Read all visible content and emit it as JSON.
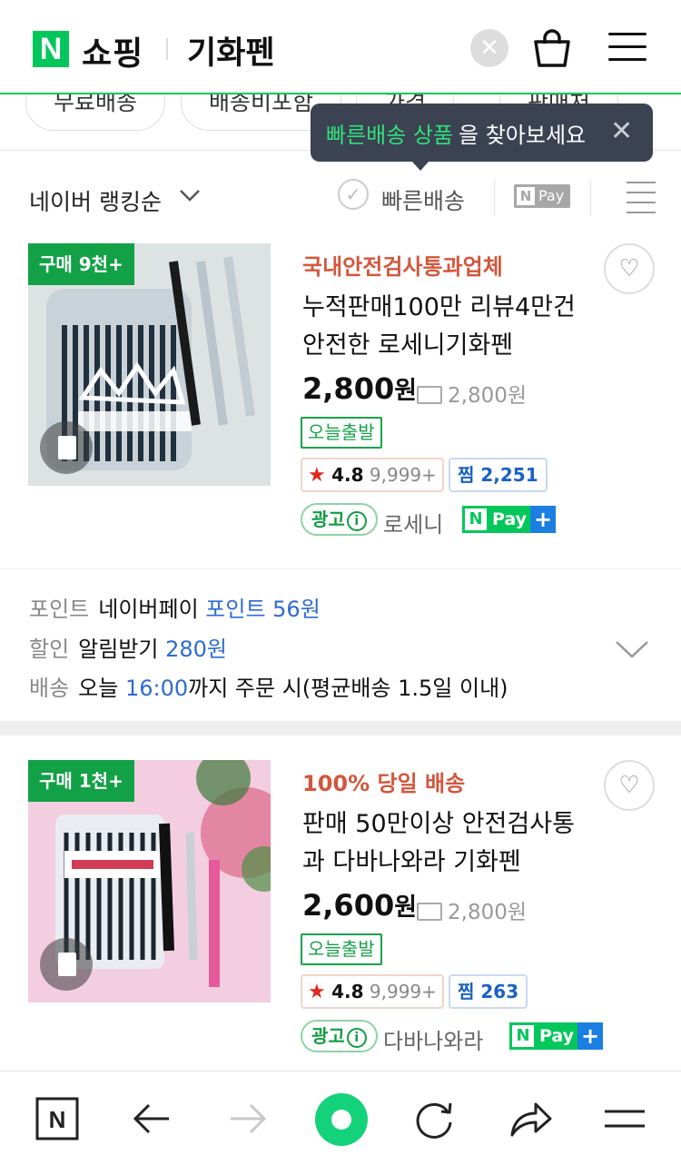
{
  "header": {
    "logo_letter": "N",
    "logo_text": "쇼핑",
    "query": "기화펜",
    "clear_glyph": "✕",
    "icons": [
      "search-clear-icon",
      "shopping-bag-icon",
      "hamburger-menu-icon"
    ]
  },
  "filters": {
    "chips": [
      "무료배송",
      "배송비포함",
      "가격",
      "판매처"
    ]
  },
  "tooltip": {
    "highlight": "빠른배송 상품",
    "text": "을 찾아보세요",
    "close": "✕"
  },
  "sort": {
    "label": "네이버 랭킹순",
    "chevron": "⌵",
    "fast_delivery": "빠른배송",
    "check": "✓",
    "npay_n": "N",
    "npay_label": "Pay"
  },
  "products": [
    {
      "buy_badge": "구매 9천+",
      "promo": "국내안전검사통과업체",
      "title": "누적판매100만 리뷰4만건 안전한 로세니기화펜",
      "price": "2,800",
      "price_unit": "원",
      "shipping": "2,800원",
      "today_ship": "오늘출발",
      "rating_star": "★",
      "rating": "4.8",
      "review_count": "9,999+",
      "zzim": "찜 2,251",
      "ad_label": "광고",
      "ad_icon": "i",
      "seller": "로세니",
      "npay_n": "N",
      "npay_label": "Pay",
      "npay_plus": "+",
      "wish_icon": "♡"
    },
    {
      "buy_badge": "구매 1천+",
      "promo": "100% 당일 배송",
      "title": "판매 50만이상 안전검사통과 다바나와라 기화펜",
      "price": "2,600",
      "price_unit": "원",
      "shipping": "2,800원",
      "today_ship": "오늘출발",
      "rating_star": "★",
      "rating": "4.8",
      "review_count": "9,999+",
      "zzim": "찜 263",
      "ad_label": "광고",
      "ad_icon": "i",
      "seller": "다바나와라",
      "npay_n": "N",
      "npay_label": "Pay",
      "npay_plus": "+",
      "wish_icon": "♡"
    }
  ],
  "info": {
    "point_key": "포인트",
    "point_text": "네이버페이 ",
    "point_value": "포인트 56원",
    "discount_key": "할인",
    "discount_text": "알림받기 ",
    "discount_value": "280원",
    "delivery_key": "배송",
    "delivery_text1": "오늘 ",
    "delivery_time": "16:00",
    "delivery_text2": "까지 주문 시(평균배송 1.5일 이내)"
  },
  "bottom_bar": {
    "icons": [
      "naver-home-icon",
      "back-arrow-icon",
      "forward-arrow-icon",
      "green-dot-icon",
      "refresh-icon",
      "share-icon",
      "menu-icon"
    ],
    "home_letter": "N"
  },
  "colors": {
    "brand_green": "#03c75a",
    "promo_red": "#d3563c",
    "link_blue": "#2d6bd2",
    "tooltip_bg": "#3b4251"
  }
}
